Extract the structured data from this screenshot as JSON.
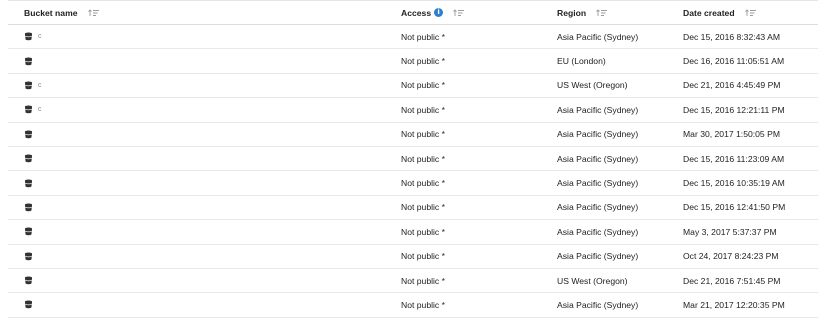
{
  "table": {
    "columns": [
      {
        "label": "Bucket name",
        "sort_icon": "sort-ascending-icon"
      },
      {
        "label": "Access",
        "info_icon": "info-icon",
        "info_glyph": "i",
        "sort_icon": "sort-ascending-icon"
      },
      {
        "label": "Region",
        "sort_icon": "sort-ascending-icon"
      },
      {
        "label": "Date created",
        "sort_icon": "sort-ascending-icon"
      }
    ],
    "rows": [
      {
        "name": "c",
        "access": "Not public *",
        "region": "Asia Pacific (Sydney)",
        "date": "Dec 15, 2016 8:32:43 AM"
      },
      {
        "name": "",
        "access": "Not public *",
        "region": "EU (London)",
        "date": "Dec 16, 2016 11:05:51 AM"
      },
      {
        "name": "c",
        "access": "Not public *",
        "region": "US West (Oregon)",
        "date": "Dec 21, 2016 4:45:49 PM"
      },
      {
        "name": "c",
        "access": "Not public *",
        "region": "Asia Pacific (Sydney)",
        "date": "Dec 15, 2016 12:21:11 PM"
      },
      {
        "name": "",
        "access": "Not public *",
        "region": "Asia Pacific (Sydney)",
        "date": "Mar 30, 2017 1:50:05 PM"
      },
      {
        "name": "",
        "access": "Not public *",
        "region": "Asia Pacific (Sydney)",
        "date": "Dec 15, 2016 11:23:09 AM"
      },
      {
        "name": "",
        "access": "Not public *",
        "region": "Asia Pacific (Sydney)",
        "date": "Dec 15, 2016 10:35:19 AM"
      },
      {
        "name": "",
        "access": "Not public *",
        "region": "Asia Pacific (Sydney)",
        "date": "Dec 15, 2016 12:41:50 PM"
      },
      {
        "name": "",
        "access": "Not public *",
        "region": "Asia Pacific (Sydney)",
        "date": "May 3, 2017 5:37:37 PM"
      },
      {
        "name": "",
        "access": "Not public *",
        "region": "Asia Pacific (Sydney)",
        "date": "Oct 24, 2017 8:24:23 PM"
      },
      {
        "name": "",
        "access": "Not public *",
        "region": "US West (Oregon)",
        "date": "Dec 21, 2016 7:51:45 PM"
      },
      {
        "name": "",
        "access": "Not public *",
        "region": "Asia Pacific (Sydney)",
        "date": "Mar 21, 2017 12:20:35 PM"
      }
    ],
    "row_icon": "bucket-icon",
    "colors": {
      "info_accent": "#2e7fd0"
    }
  }
}
